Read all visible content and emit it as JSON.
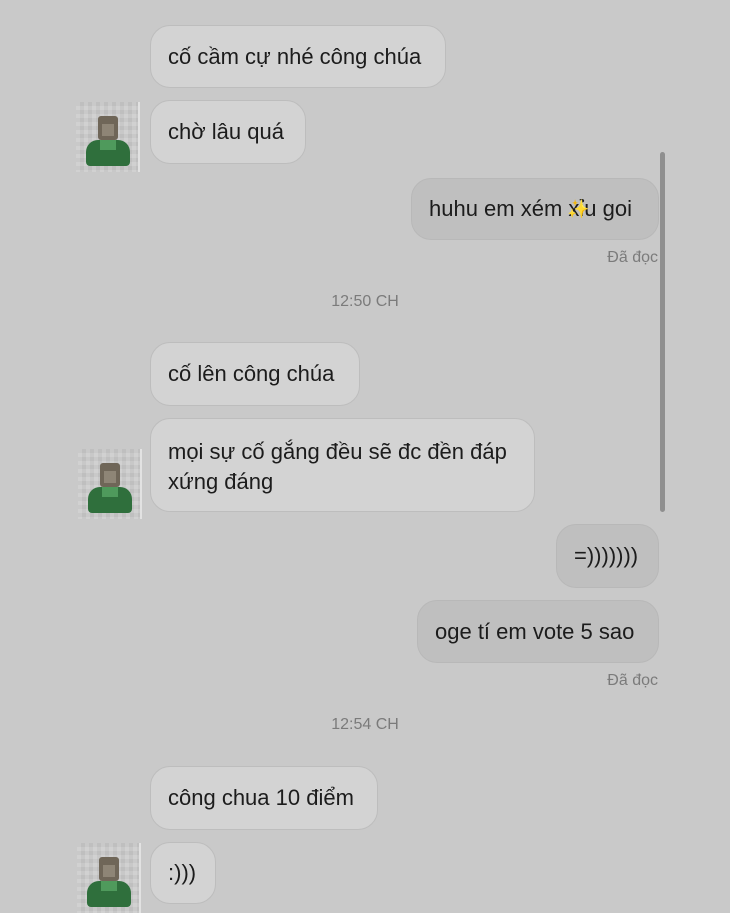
{
  "messages": {
    "m1": "cố cầm cự nhé công chúa",
    "m2": "chờ lâu quá",
    "m3": "huhu em xém xỉu goi",
    "m4": "cố lên công chúa",
    "m5": "mọi sự cố gắng đều sẽ đc đền đáp xứng đáng",
    "m6": "=)))))))",
    "m7": "oge tí em vote 5 sao",
    "m8": "công chua 10 điểm",
    "m9": ":)))"
  },
  "status": {
    "read_1": "Đã đọc",
    "read_2": "Đã đọc"
  },
  "timestamps": {
    "t1": "12:50 CH",
    "t2": "12:54 CH"
  },
  "icons": {
    "sparkle": "✨",
    "avatar": "contact-avatar"
  },
  "colors": {
    "background": "#c9c9c9",
    "incoming_bubble": "#d3d3d3",
    "outgoing_bubble": "#bfbfbf",
    "meta_text": "#7b7b7b"
  }
}
